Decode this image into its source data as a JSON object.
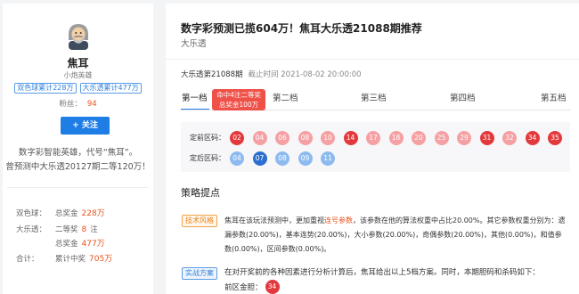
{
  "sidebar": {
    "avatar_icon": "bearded-old-man-avatar",
    "name": "焦耳",
    "rank": "小炮英雄",
    "tags": [
      "双色球累计228万",
      "大乐透累计477万"
    ],
    "fans_label": "粉丝：",
    "fans_count": "94",
    "follow_button": "+ 关注",
    "description": [
      "数字彩智能英雄，代号“焦耳”。",
      "曾预测中大乐透20127期二等120万！"
    ],
    "stats": [
      {
        "label": "双色球：",
        "key": "总奖金",
        "value": "228万"
      },
      {
        "label": "大乐透：",
        "key": "二等奖",
        "value": "8",
        "unit": "注"
      },
      {
        "key": "总奖金",
        "value": "477万"
      },
      {
        "label": "合计：",
        "key": "累计中奖",
        "value": "705万"
      }
    ]
  },
  "main": {
    "title": "数字彩预测已揽604万！焦耳大乐透21088期推荐",
    "subtitle": "大乐透",
    "issue": "大乐透第21088期",
    "deadline_label": "截止时间",
    "deadline": "2021-08-02 20:00:00",
    "tabs": [
      "第一档",
      "第二档",
      "第三档",
      "第四档",
      "第五档"
    ],
    "active_tab": 0,
    "hit_badge": [
      "命中4注二等奖",
      "总奖金100万"
    ],
    "front_label": "定前区码：",
    "front_numbers": [
      {
        "n": "02",
        "hit": true
      },
      {
        "n": "04",
        "hit": false
      },
      {
        "n": "06",
        "hit": false
      },
      {
        "n": "08",
        "hit": false
      },
      {
        "n": "10",
        "hit": false
      },
      {
        "n": "14",
        "hit": true
      },
      {
        "n": "17",
        "hit": false
      },
      {
        "n": "18",
        "hit": false
      },
      {
        "n": "20",
        "hit": false
      },
      {
        "n": "25",
        "hit": false
      },
      {
        "n": "29",
        "hit": false
      },
      {
        "n": "31",
        "hit": true
      },
      {
        "n": "32",
        "hit": false
      },
      {
        "n": "34",
        "hit": true
      },
      {
        "n": "35",
        "hit": true
      }
    ],
    "back_label": "定后区码：",
    "back_numbers": [
      {
        "n": "04",
        "hit": false
      },
      {
        "n": "07",
        "hit": true
      },
      {
        "n": "08",
        "hit": false
      },
      {
        "n": "09",
        "hit": false
      },
      {
        "n": "11",
        "hit": false
      }
    ],
    "strategy_heading": "策略提点",
    "tech": {
      "tag": "技术风格",
      "text_before": "焦耳在该玩法预测中，更加重视",
      "highlight": "连号参数",
      "text_after": "，该参数在他的算法权重中占比20.00%。其它参数权重分别为：遗漏参数(20.00%)，基本连势(20.00%)，大小参数(20.00%)，奇偶参数(20.00%)，其他(0.00%)，和值参数(0.00%)，区间参数(0.00%)。"
    },
    "plan": {
      "tag": "实战方案",
      "text": "在对开奖前的各种因素进行分析计算后，焦耳给出以上5档方案。同时，本期胆码和杀码如下：",
      "gold_label": "前区金胆：",
      "gold_number": "34"
    }
  },
  "colors": {
    "accent": "#1f7ee6",
    "highlight": "#e8531d",
    "front_ball": "#f5a0a3",
    "front_ball_hit": "#e4393c",
    "back_ball": "#8dbbef",
    "back_ball_hit": "#2c6fd1"
  }
}
